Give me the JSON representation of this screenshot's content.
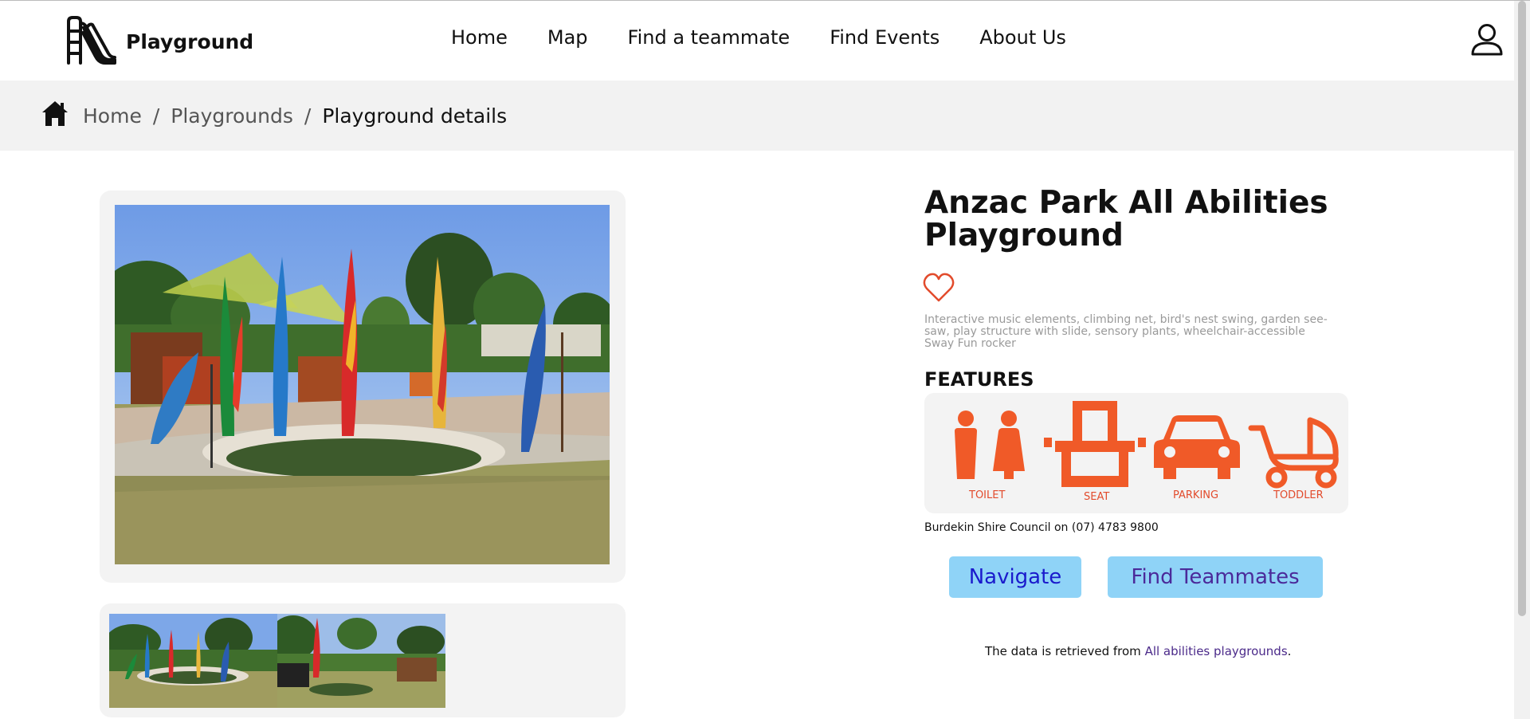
{
  "header": {
    "logo_text": "Playground",
    "nav": [
      "Home",
      "Map",
      "Find a teammate",
      "Find Events",
      "About Us"
    ],
    "logo_icon": "slide-icon",
    "user_icon": "user-icon"
  },
  "breadcrumb": {
    "items": [
      "Home",
      "Playgrounds"
    ],
    "current": "Playground details",
    "separator": "/"
  },
  "playground": {
    "title": "Anzac Park All Abilities Playground",
    "description": "Interactive music elements, climbing net, bird's nest swing, garden see-saw, play structure with slide, sensory plants, wheelchair-accessible Sway Fun rocker",
    "features_heading": "FEATURES",
    "features": [
      {
        "label": "TOILET",
        "icon": "toilet-icon"
      },
      {
        "label": "SEAT",
        "icon": "seat-icon"
      },
      {
        "label": "PARKING",
        "icon": "parking-icon"
      },
      {
        "label": "TODDLER",
        "icon": "toddler-icon"
      }
    ],
    "contact": "Burdekin Shire Council on (07) 4783 9800"
  },
  "buttons": {
    "navigate": "Navigate",
    "find_teammates": "Find Teammates"
  },
  "source": {
    "prefix": "The data is retrieved from ",
    "link": "All abilities playgrounds",
    "suffix": "."
  },
  "colors": {
    "accent": "#e24b2c",
    "button_bg": "#8fd3f7",
    "panel_bg": "#f3f3f3",
    "crumb_bg": "#f2f2f2"
  }
}
